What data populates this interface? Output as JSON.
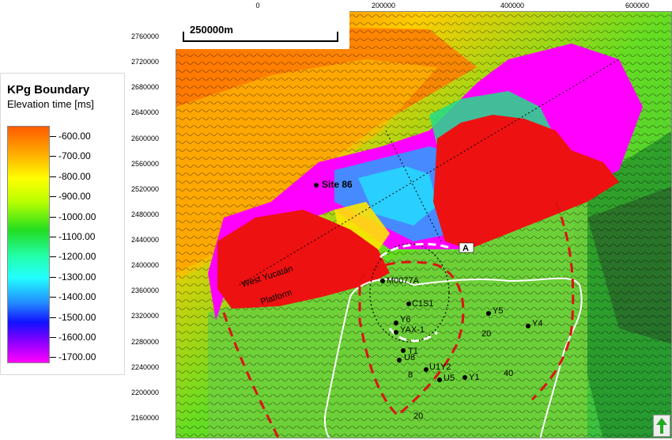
{
  "legend": {
    "title": "KPg Boundary",
    "subtitle": "Elevation time [ms]",
    "labels": [
      "-600.00",
      "-700.00",
      "-800.00",
      "-900.00",
      "-1000.00",
      "-1100.00",
      "-1200.00",
      "-1300.00",
      "-1400.00",
      "-1500.00",
      "-1600.00",
      "-1700.00"
    ]
  },
  "axes": {
    "x_ticks": [
      "0",
      "200000",
      "400000",
      "600000"
    ],
    "y_ticks": [
      "2760000",
      "2720000",
      "2680000",
      "2640000",
      "2600000",
      "2560000",
      "2520000",
      "2480000",
      "2440000",
      "2400000",
      "2360000",
      "2320000",
      "2280000",
      "2240000",
      "2200000",
      "2160000"
    ]
  },
  "scale_bar": {
    "label": "250000m"
  },
  "map": {
    "site_label": "Site 86",
    "platform_label_1": "West Yucatán",
    "platform_label_2": "Platform",
    "profile_label": "A",
    "wells": {
      "m0077a": "M0077A",
      "c1": "C1",
      "s1": "S1",
      "y6": "Y6",
      "yax1": "YAX-1",
      "t1": "T1",
      "u8": "U8",
      "u1": "U1",
      "y2": "Y2",
      "u5": "U5",
      "y1": "Y1",
      "y5": "Y5",
      "y4": "Y4"
    },
    "contours": {
      "c20a": "20",
      "c8": "8",
      "c40": "40",
      "c20b": "20",
      "c30": "20"
    }
  },
  "colors": {
    "orange": "#ff5a00",
    "red": "#ff0000",
    "magenta": "#ff00ff",
    "green": "#7acc40",
    "dashed_red": "#dd1111"
  },
  "icons": {
    "north": "north-arrow-icon"
  }
}
